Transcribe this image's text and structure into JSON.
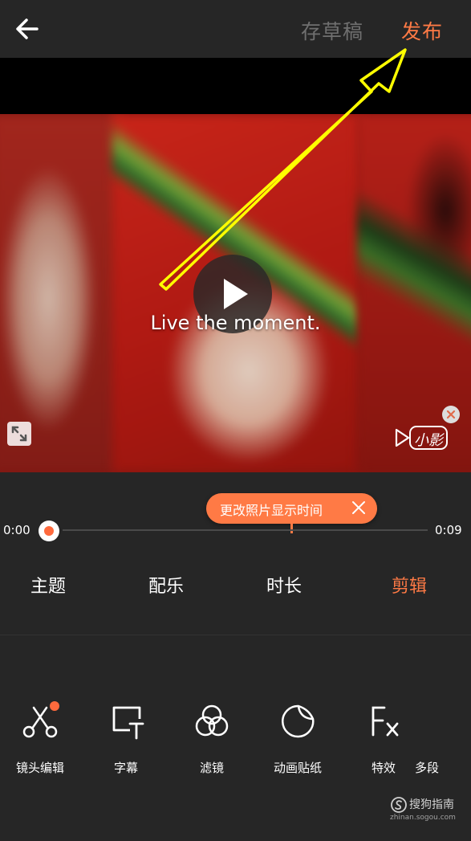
{
  "header": {
    "back_icon": "arrow-left-icon",
    "draft_label": "存草稿",
    "publish_label": "发布"
  },
  "preview": {
    "caption": "Live the moment.",
    "play_icon": "play-icon",
    "expand_icon": "expand-icon",
    "logo_text": "小影"
  },
  "timeline": {
    "start_time": "0:00",
    "end_time": "0:09",
    "tip": "更改照片显示时间",
    "progress": 0
  },
  "tabs": [
    {
      "label": "主题",
      "active": false
    },
    {
      "label": "配乐",
      "active": false
    },
    {
      "label": "时长",
      "active": false
    },
    {
      "label": "剪辑",
      "active": true
    }
  ],
  "tools": [
    {
      "label": "镜头编辑",
      "icon": "scissors-icon",
      "badge": true
    },
    {
      "label": "字幕",
      "icon": "subtitle-icon"
    },
    {
      "label": "滤镜",
      "icon": "filter-icon"
    },
    {
      "label": "动画贴纸",
      "icon": "sticker-icon"
    },
    {
      "label": "特效",
      "icon": "fx-icon"
    },
    {
      "label": "多段",
      "icon": "music-note-icon"
    }
  ],
  "watermark": {
    "text": "搜狗指南",
    "sub": "zhinan.sogou.com"
  },
  "colors": {
    "accent": "#ff7a45",
    "bar_bg": "#262626",
    "annotation_arrow": "#ffff00"
  }
}
